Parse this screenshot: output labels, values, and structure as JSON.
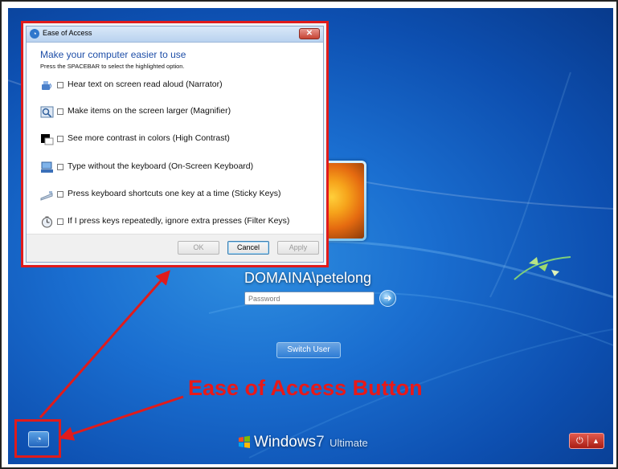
{
  "dialog": {
    "title": "Ease of Access",
    "heading": "Make your computer easier to use",
    "instruction": "Press the SPACEBAR to select the highlighted option.",
    "options": [
      {
        "label": "Hear text on screen read aloud (Narrator)",
        "icon": "narrator-icon",
        "checked": false
      },
      {
        "label": "Make items on the screen larger (Magnifier)",
        "icon": "magnifier-icon",
        "checked": false
      },
      {
        "label": "See more contrast in colors (High Contrast)",
        "icon": "high-contrast-icon",
        "checked": false
      },
      {
        "label": "Type without the keyboard (On-Screen Keyboard)",
        "icon": "keyboard-icon",
        "checked": false
      },
      {
        "label": "Press keyboard shortcuts one key at a time (Sticky Keys)",
        "icon": "sticky-keys-icon",
        "checked": false
      },
      {
        "label": "If I press keys repeatedly, ignore extra presses (Filter Keys)",
        "icon": "filter-keys-icon",
        "checked": false
      }
    ],
    "buttons": {
      "ok": "OK",
      "cancel": "Cancel",
      "apply": "Apply"
    }
  },
  "login": {
    "username": "DOMAINA\\petelong",
    "password_placeholder": "Password",
    "switch_user": "Switch User"
  },
  "annotation": {
    "label": "Ease of Access Button",
    "color": "#e81919"
  },
  "branding": {
    "name": "Windows",
    "version": "7",
    "edition": "Ultimate"
  }
}
